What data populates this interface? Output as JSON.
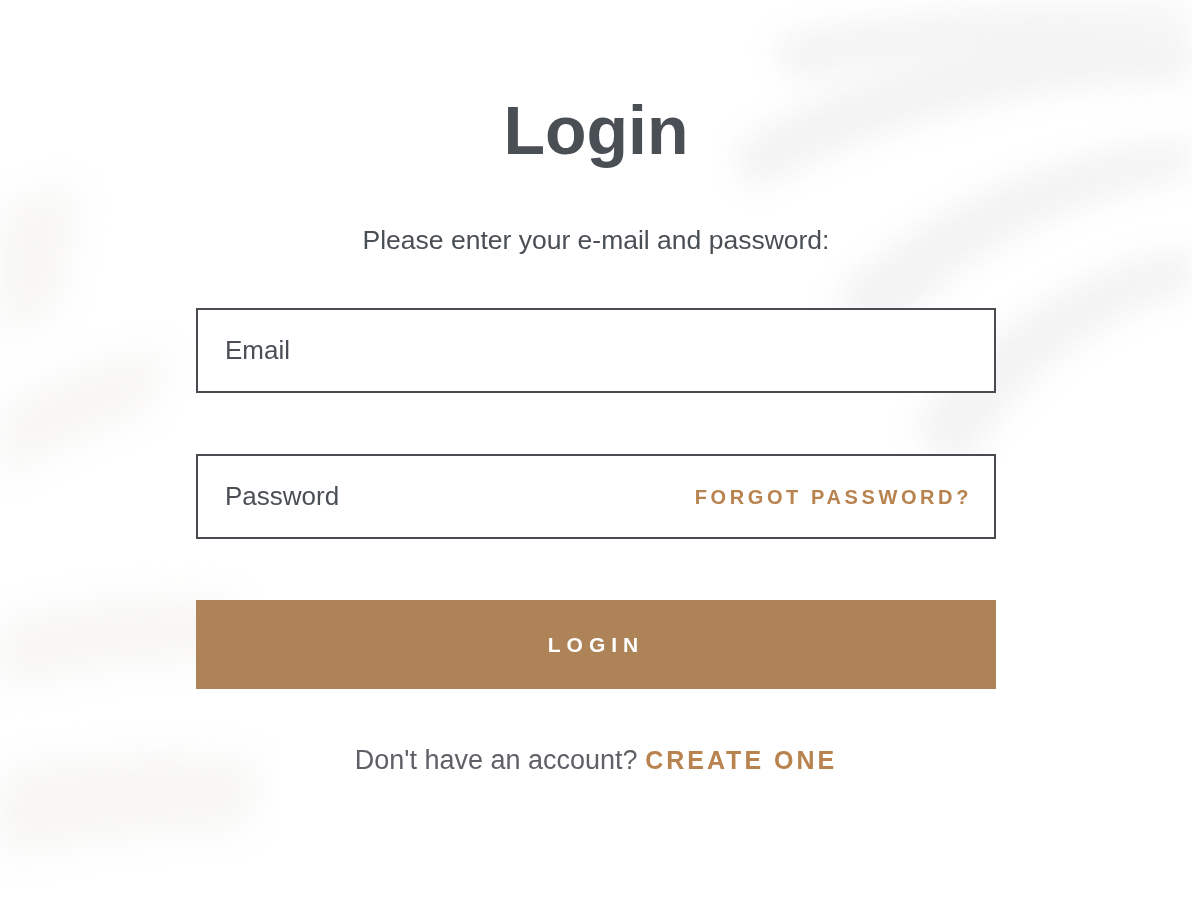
{
  "title": "Login",
  "subtitle": "Please enter your e-mail and password:",
  "fields": [
    {
      "placeholder": "Email"
    },
    {
      "placeholder": "Password",
      "link": "FORGOT PASSWORD?"
    }
  ],
  "submit": {
    "label": "LOGIN"
  },
  "footer": {
    "prompt": "Don't have an account?",
    "link": "CREATE ONE"
  }
}
